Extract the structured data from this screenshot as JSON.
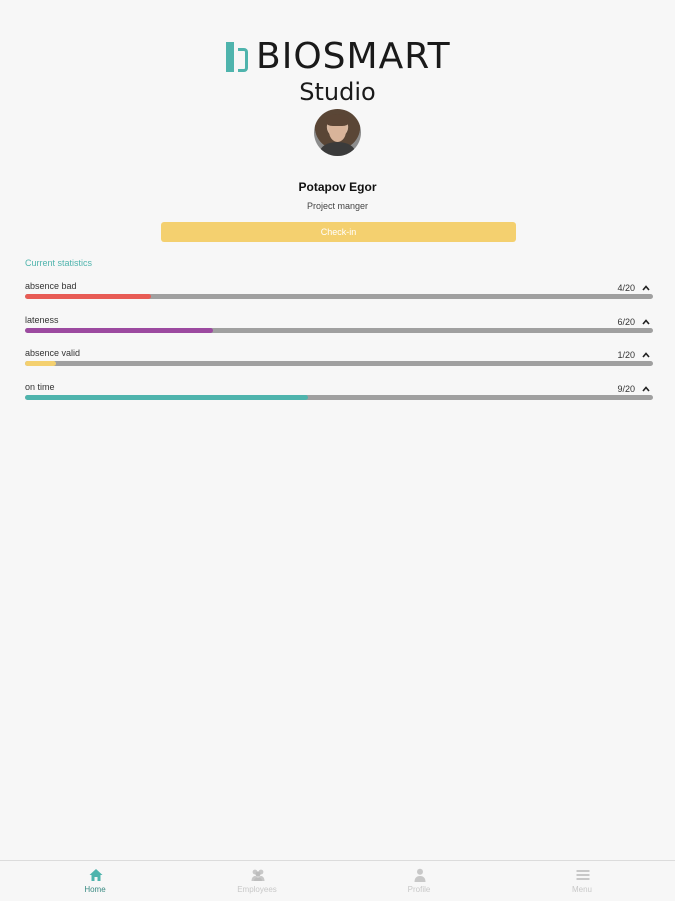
{
  "brand": {
    "name": "BIOSMART",
    "subtitle": "Studio",
    "accent_color": "#4fb4ad"
  },
  "profile": {
    "name": "Potapov Egor",
    "role": "Project manger",
    "avatar_icon": "user-photo"
  },
  "checkin_button": {
    "label": "Check-in",
    "color": "#f4d06f"
  },
  "statistics": {
    "title": "Current statistics",
    "items": [
      {
        "label": "absence bad",
        "count": "4/20",
        "value": 4,
        "total": 20,
        "color": "#e85c55"
      },
      {
        "label": "lateness",
        "count": "6/20",
        "value": 6,
        "total": 20,
        "color": "#9c4aa0"
      },
      {
        "label": "absence valid",
        "count": "1/20",
        "value": 1,
        "total": 20,
        "color": "#f4d06f"
      },
      {
        "label": "on time",
        "count": "9/20",
        "value": 9,
        "total": 20,
        "color": "#4fb4ad"
      }
    ]
  },
  "nav": {
    "items": [
      {
        "label": "Home",
        "icon": "home-icon",
        "active": true
      },
      {
        "label": "Employees",
        "icon": "employees-icon",
        "active": false
      },
      {
        "label": "Profile",
        "icon": "profile-icon",
        "active": false
      },
      {
        "label": "Menu",
        "icon": "menu-icon",
        "active": false
      }
    ]
  }
}
